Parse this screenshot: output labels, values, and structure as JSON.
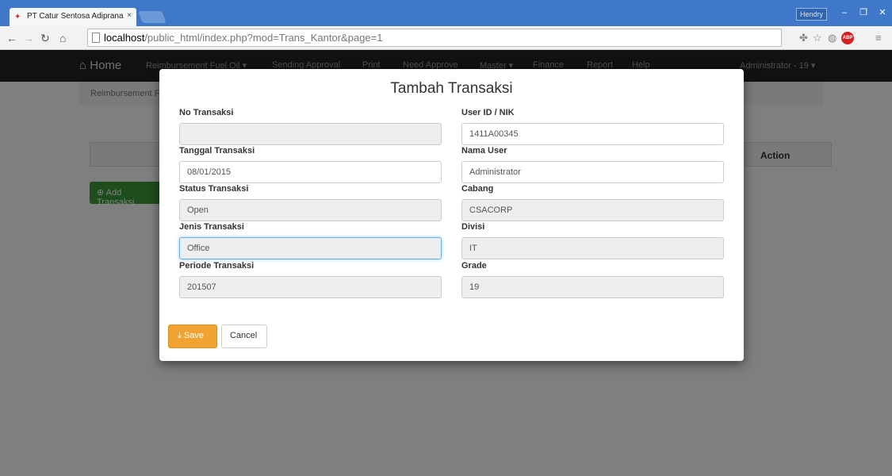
{
  "browser": {
    "tab_title": "PT Catur Sentosa Adiprana",
    "tab_close": "×",
    "user_badge": "Hendry",
    "url_host": "localhost",
    "url_path": "/public_html/index.php?mod=Trans_Kantor&page=1"
  },
  "navbar": {
    "home": "Home",
    "items": [
      "Reimbursement Fuel Oil ▾",
      "Sending Approval",
      "Print",
      "Need Approve",
      "Master ▾",
      "Finance",
      "Report",
      "Help"
    ],
    "user": "Administrator - 19 ▾"
  },
  "breadcrumb": "Reimbursement Fuel Oil",
  "table": {
    "action_header": "Action"
  },
  "add_button": "Add Transaksi",
  "modal": {
    "title": "Tambah Transaksi",
    "left": [
      {
        "label": "No Transaksi",
        "value": ""
      },
      {
        "label": "Tanggal Transaksi",
        "value": "08/01/2015"
      },
      {
        "label": "Status Transaksi",
        "value": "Open"
      },
      {
        "label": "Jenis Transaksi",
        "value": "Office"
      },
      {
        "label": "Periode Transaksi",
        "value": "201507"
      }
    ],
    "right": [
      {
        "label": "User ID / NIK",
        "value": "1411A00345"
      },
      {
        "label": "Nama User",
        "value": "Administrator"
      },
      {
        "label": "Cabang",
        "value": "CSACORP"
      },
      {
        "label": "Divisi",
        "value": "IT"
      },
      {
        "label": "Grade",
        "value": "19"
      }
    ],
    "save_label": "Save",
    "cancel_label": "Cancel"
  },
  "colors": {
    "navbar": "#222222",
    "save": "#f0a330",
    "add": "#3c9a3c",
    "tabstrip": "#3f78c9"
  }
}
